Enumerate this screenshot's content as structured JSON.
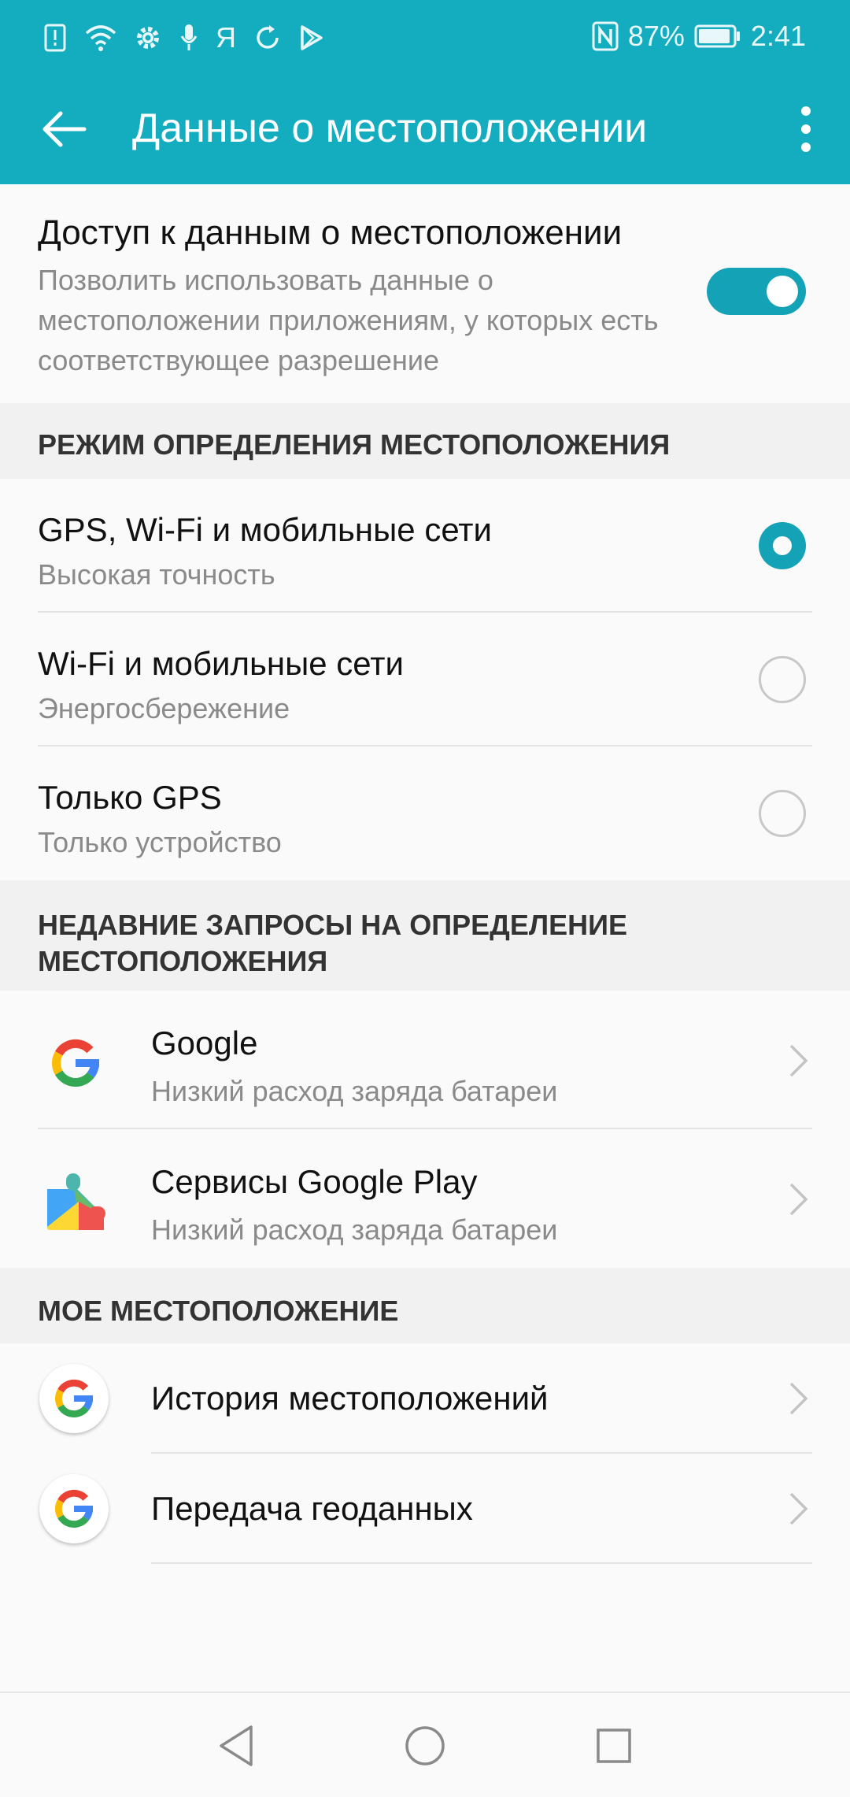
{
  "status_bar": {
    "nfc": "N",
    "battery_percent": "87%",
    "time": "2:41",
    "left_icons": [
      "alert-icon",
      "wifi-icon",
      "settings-icon",
      "mic-icon",
      "yandex-icon",
      "sync-icon",
      "play-store-icon"
    ],
    "yandex_glyph": "Я"
  },
  "app_bar": {
    "title": "Данные о местоположении"
  },
  "master_switch": {
    "title": "Доступ к данным о местоположении",
    "description": "Позволить использовать данные о местоположении приложениям, у которых есть соответствующее разрешение",
    "enabled": true
  },
  "mode_section": {
    "header": "РЕЖИМ ОПРЕДЕЛЕНИЯ МЕСТОПОЛОЖЕНИЯ",
    "options": [
      {
        "title": "GPS, Wi-Fi и мобильные сети",
        "subtitle": "Высокая точность",
        "selected": true
      },
      {
        "title": "Wi-Fi и мобильные сети",
        "subtitle": "Энергосбережение",
        "selected": false
      },
      {
        "title": "Только GPS",
        "subtitle": "Только устройство",
        "selected": false
      }
    ]
  },
  "recent_section": {
    "header": "НЕДАВНИЕ ЗАПРОСЫ НА ОПРЕДЕЛЕНИЕ МЕСТОПОЛОЖЕНИЯ",
    "apps": [
      {
        "name": "Google",
        "subtitle": "Низкий расход заряда батареи",
        "icon": "google-icon"
      },
      {
        "name": "Сервисы Google Play",
        "subtitle": "Низкий расход заряда батареи",
        "icon": "google-play-services-icon"
      }
    ]
  },
  "my_location_section": {
    "header": "МОЕ МЕСТОПОЛОЖЕНИЕ",
    "items": [
      {
        "title": "История местоположений",
        "icon": "google-icon"
      },
      {
        "title": "Передача геоданных",
        "icon": "google-icon"
      }
    ]
  },
  "colors": {
    "accent": "#14acbf",
    "toggle_on": "#14a3b6",
    "header_bg": "#f1f1f1",
    "secondary_text": "#8a8a8a"
  }
}
